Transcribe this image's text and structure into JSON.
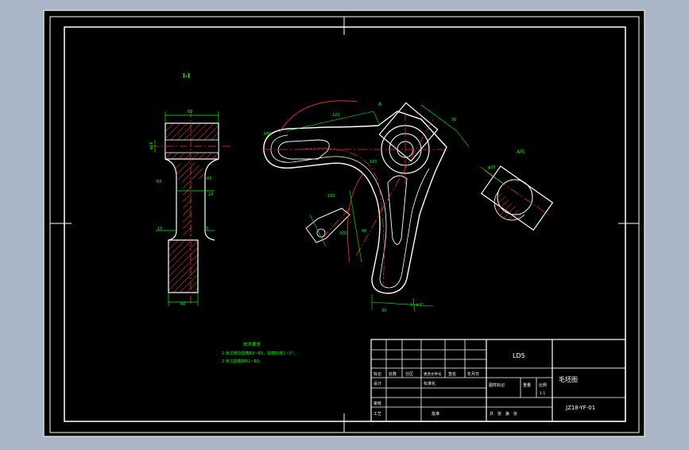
{
  "view_label": "I-I",
  "side_label": "A向",
  "section_marker": "A",
  "notes": {
    "title": "技术要求",
    "lines": [
      "1.未注铸造圆角R3~R5，拔模斜度1~3°，",
      "2.未注圆角按R1~R2。"
    ]
  },
  "title_block": {
    "material": "LD5",
    "drawing_name": "毛坯图",
    "drawing_number": "JZ18-YF-01",
    "sheet_stage": "图样标记",
    "weight": "重量",
    "scale": "比例",
    "scale_value": "1:1",
    "sheet_info": "共　张　第　张",
    "header_cells": [
      "标记",
      "处数",
      "分区",
      "更改文件号",
      "签名",
      "年月日"
    ],
    "sign_rows": [
      "设计",
      "审核",
      "工艺"
    ],
    "standardization": "标准化",
    "approve": "批准"
  },
  "dimensions": {
    "section_top_width": "60",
    "section_left_dia": "φ16",
    "section_mid_1": "R5",
    "section_mid_2": "R5",
    "section_mid_3": "24",
    "section_neck_1": "15",
    "section_neck_2": "15",
    "section_bottom": "40",
    "arm_r1": "R60",
    "arm_top": "120",
    "arm_slant": "30",
    "arm_side": "100",
    "arm_lower_1": "180",
    "arm_lower_2": "40",
    "arm_bottom": "1° ±1°",
    "arm_base": "30",
    "arm_detail": "R50",
    "side_dim": "φ26"
  }
}
